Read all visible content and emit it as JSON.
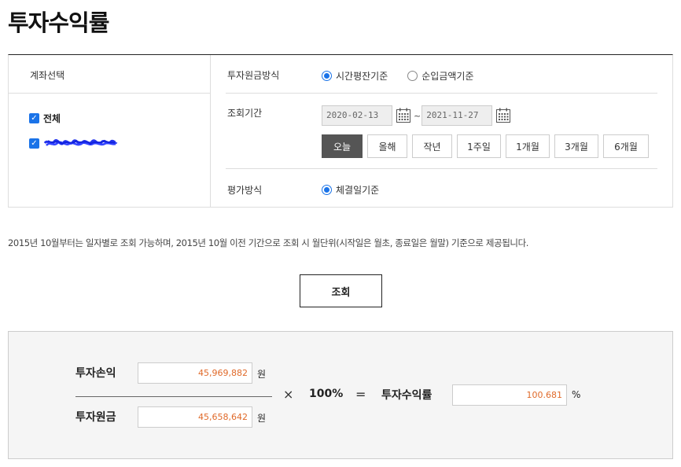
{
  "page_title": "투자수익률",
  "account": {
    "header": "계좌선택",
    "all_label": "전체"
  },
  "options": {
    "principal_label": "투자원금방식",
    "principal_options": [
      {
        "label": "시간평잔기준",
        "selected": true
      },
      {
        "label": "순입금액기준",
        "selected": false
      }
    ],
    "period_label": "조회기간",
    "start_date": "2020-02-13",
    "end_date": "2021-11-27",
    "tilde": "~",
    "period_buttons": [
      "오늘",
      "올해",
      "작년",
      "1주일",
      "1개월",
      "3개월",
      "6개월"
    ],
    "active_period": "오늘",
    "eval_label": "평가방식",
    "eval_option": "체결일기준"
  },
  "notice": "2015년 10월부터는 일자별로 조회 가능하며, 2015년 10월 이전 기간으로 조회 시 월단위(시작일은 월초, 종료일은 월말) 기준으로 제공됩니다.",
  "query_button": "조회",
  "result": {
    "profit_label": "투자손익",
    "profit_value": "45,969,882",
    "principal_label": "투자원금",
    "principal_value": "45,658,642",
    "currency_unit": "원",
    "multiply_sign": "×",
    "hundred_pct": "100%",
    "equals_sign": "=",
    "rate_label": "투자수익률",
    "rate_value": "100.681",
    "percent_sign": "%"
  },
  "colors": {
    "accent_blue": "#1a73e8",
    "value_orange": "#e06a2a",
    "active_button": "#555555"
  }
}
